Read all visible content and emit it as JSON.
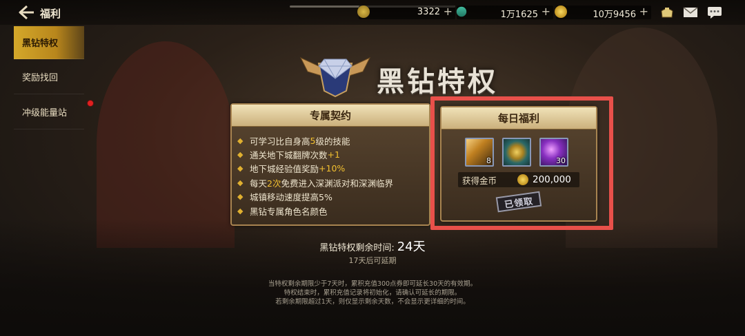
{
  "header": {
    "title": "福利",
    "currencies": [
      {
        "value": "3322",
        "icon": "energy-coin-icon"
      },
      {
        "value": "1万1625",
        "icon": "gem-icon"
      },
      {
        "value": "10万9456",
        "icon": "gold-coin-icon"
      }
    ],
    "plus": "+"
  },
  "sidebar": {
    "items": [
      {
        "label": "黑钻特权",
        "active": true
      },
      {
        "label": "奖励找回",
        "active": false
      },
      {
        "label": "冲级能量站",
        "active": false,
        "badge": "red-dot"
      }
    ]
  },
  "main": {
    "title": "黑钻特权",
    "contract": {
      "heading": "专属契约",
      "benefits": [
        {
          "before": "可学习比自身高",
          "hl": "5",
          "after": "级的技能"
        },
        {
          "before": "通关地下城翻牌次数",
          "hl": "+1",
          "after": ""
        },
        {
          "before": "地下城经验值奖励",
          "hl": "+10%",
          "after": ""
        },
        {
          "before": "每天",
          "hl": "2次",
          "after": "免费进入深渊派对和深渊临界"
        },
        {
          "before": "城镇移动速度提高5%",
          "hl": "",
          "after": ""
        },
        {
          "before": "黑钻专属角色名颜色",
          "hl": "",
          "after": ""
        }
      ]
    },
    "daily": {
      "heading": "每日福利",
      "rewards": [
        {
          "icon": "gauntlet-icon",
          "qty": "8"
        },
        {
          "icon": "gold-medal-icon",
          "qty": ""
        },
        {
          "icon": "purple-orb-icon",
          "qty": "30"
        }
      ],
      "coin_label": "获得金币",
      "coin_value": "200,000",
      "claimed": "已领取"
    },
    "remaining_label": "黑钻特权剩余时间:",
    "remaining_days": "24天",
    "extend_note": "17天后可延期",
    "notes": [
      "当特权剩余期限少于7天时，累积充值300点券即可延长30天的有效期。",
      "特权结束时，累积充值记录将初始化，请确认可延长的期限。",
      "若剩余期限超过1天，则仅显示剩余天数，不会显示更详细的时间。"
    ]
  },
  "colors": {
    "highlight_box": "#e8504a",
    "accent_gold": "#f2c030",
    "active_tab": "#d4a82a"
  }
}
